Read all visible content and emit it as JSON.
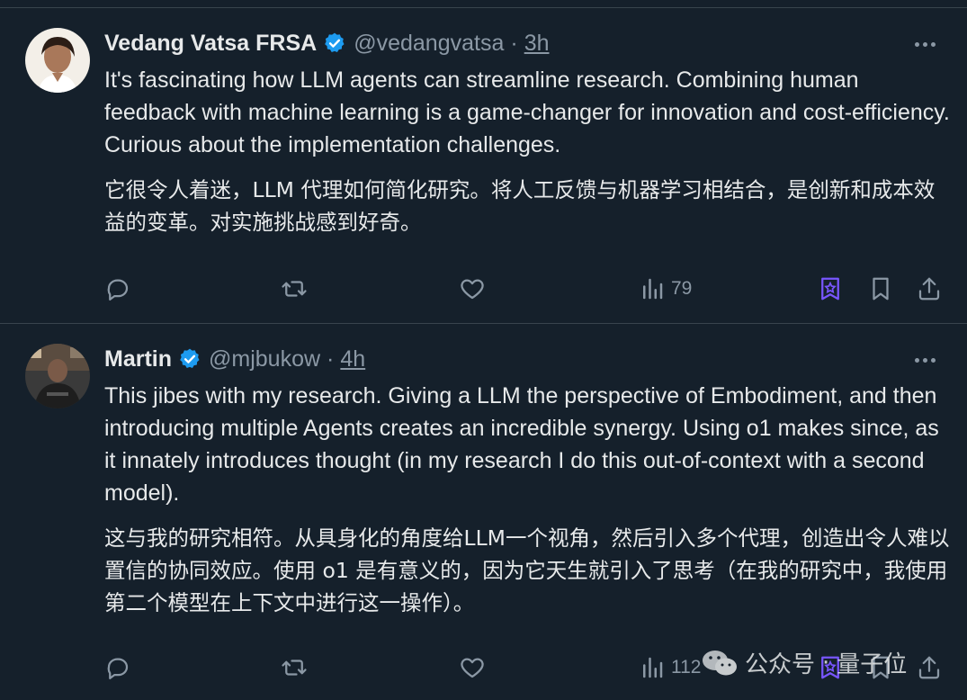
{
  "tweets": [
    {
      "name": "Vedang Vatsa FRSA",
      "handle": "@vedangvatsa",
      "separator": "·",
      "time": "3h",
      "text_en": "It's fascinating how LLM agents can streamline research. Combining human feedback with machine learning is a game-changer for innovation and cost-efficiency. Curious about the implementation challenges.",
      "text_zh": "它很令人着迷，LLM 代理如何简化研究。将人工反馈与机器学习相结合，是创新和成本效益的变革。对实施挑战感到好奇。",
      "views": "79"
    },
    {
      "name": "Martin",
      "handle": "@mjbukow",
      "separator": "·",
      "time": "4h",
      "text_en": "This jibes with my research. Giving a LLM the perspective of Embodiment, and then introducing multiple Agents creates an incredible synergy. Using o1 makes since, as it innately introduces thought (in my research I do this out-of-context with a second model).",
      "text_zh": "这与我的研究相符。从具身化的角度给LLM一个视角，然后引入多个代理，创造出令人难以置信的协同效应。使用 o1 是有意义的，因为它天生就引入了思考（在我的研究中，我使用第二个模型在上下文中进行这一操作）。",
      "views": "112"
    }
  ],
  "watermark": {
    "platform": "公众号",
    "separator": "·",
    "account": "量子位"
  },
  "colors": {
    "background": "#15202b",
    "text": "#e7e9ea",
    "muted": "#8b98a5",
    "verified": "#1d9bf0",
    "grok": "#7856ff"
  },
  "icons": [
    "reply-icon",
    "retweet-icon",
    "like-icon",
    "views-icon",
    "grok-icon",
    "bookmark-icon",
    "share-icon",
    "more-icon",
    "verified-badge-icon"
  ]
}
